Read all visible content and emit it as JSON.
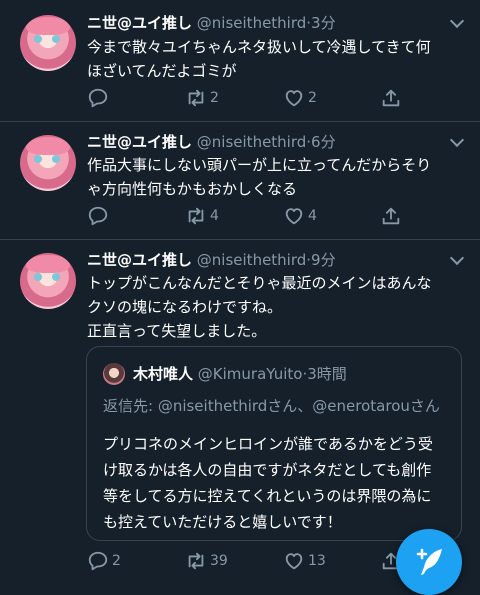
{
  "tweets": [
    {
      "name": "ニ世@ユイ推し",
      "handle": "@niseithethird",
      "time": "·3分",
      "text": "今まで散々ユイちゃんネタ扱いして冷遇してきて何\nほざいてんだよゴミが",
      "replies": "",
      "retweets": "2",
      "likes": "2"
    },
    {
      "name": "ニ世@ユイ推し",
      "handle": "@niseithethird",
      "time": "·6分",
      "text": "作品大事にしない頭パーが上に立ってんだからそり\nゃ方向性何もかもおかしくなる",
      "replies": "",
      "retweets": "4",
      "likes": "4"
    },
    {
      "name": "ニ世@ユイ推し",
      "handle": "@niseithethird",
      "time": "·9分",
      "text": "トップがこんなんだとそりゃ最近のメインはあんな\nクソの塊になるわけですね。\n正直言って失望しました。",
      "replies": "2",
      "retweets": "39",
      "likes": "13"
    }
  ],
  "quote": {
    "name": "木村唯人",
    "handle": "@KimuraYuito",
    "time": "·3時間",
    "reply_to": "返信先: @niseithethirdさん、@enerotarouさん",
    "text": "プリコネのメインヒロインが誰であるかをどう受\nけ取るかは各人の自由ですがネタだとしても創作\n等をしてる方に控えてくれというのは界隈の為に\nも控えていただけると嬉しいです！"
  },
  "colors": {
    "background": "#15202b",
    "border": "#38444d",
    "secondary_text": "#8899a6",
    "accent": "#1da1f2"
  },
  "icons": [
    "reply-icon",
    "retweet-icon",
    "like-icon",
    "share-icon",
    "caret-down-icon",
    "compose-tweet-icon"
  ]
}
